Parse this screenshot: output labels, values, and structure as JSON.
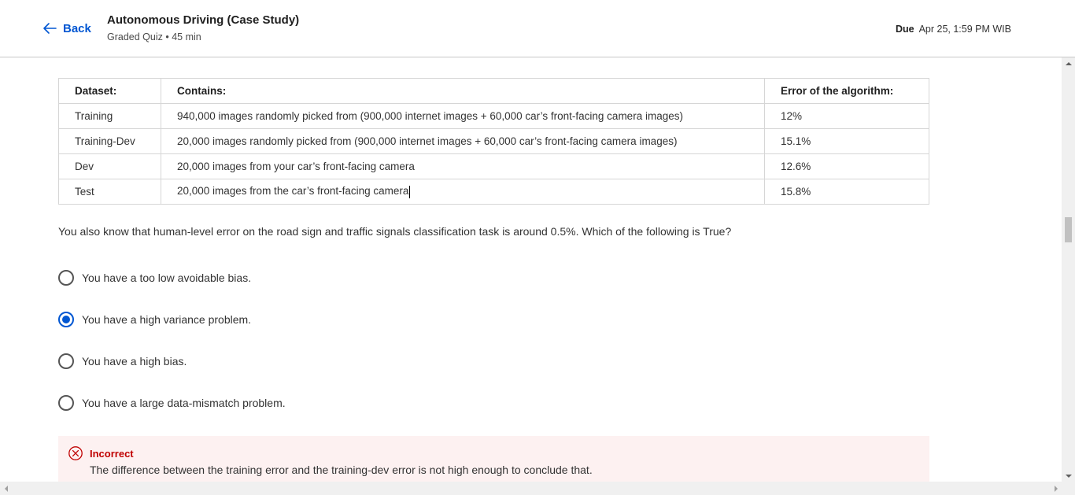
{
  "header": {
    "back_label": "Back",
    "title": "Autonomous Driving (Case Study)",
    "subtitle": "Graded Quiz • 45 min",
    "due_label": "Due",
    "due_value": "Apr 25, 1:59 PM WIB"
  },
  "table": {
    "headers": [
      "Dataset:",
      "Contains:",
      "Error of the algorithm:"
    ],
    "rows": [
      [
        "Training",
        "940,000 images randomly picked from (900,000 internet images + 60,000 car’s front-facing camera images)",
        "12%"
      ],
      [
        "Training-Dev",
        "20,000 images randomly picked from (900,000 internet images + 60,000 car’s front-facing camera images)",
        "15.1%"
      ],
      [
        "Dev",
        "20,000 images from your car’s front-facing camera",
        "12.6%"
      ],
      [
        "Test",
        "20,000 images from the car’s front-facing camera",
        "15.8%"
      ]
    ]
  },
  "question": "You also know that human-level error on the road sign and traffic signals classification task is around 0.5%. Which of the following is True?",
  "options": [
    {
      "label": "You have a too low avoidable bias.",
      "selected": false
    },
    {
      "label": "You have a high variance problem.",
      "selected": true
    },
    {
      "label": "You have a high bias.",
      "selected": false
    },
    {
      "label": "You have a large data-mismatch problem.",
      "selected": false
    }
  ],
  "feedback": {
    "status": "Incorrect",
    "text": "The difference between the training error and the training-dev error is not high enough to conclude that."
  },
  "colors": {
    "accent": "#0056d2",
    "error": "#c00000",
    "feedback_bg": "#fdf1f1"
  },
  "icons": {
    "back": "arrow-left-icon",
    "feedback": "close-circle-icon"
  }
}
